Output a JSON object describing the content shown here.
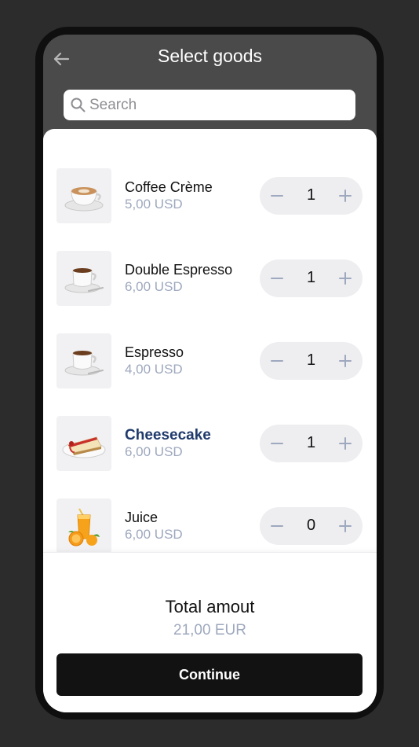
{
  "header": {
    "title": "Select goods",
    "back_icon": "arrow-left-icon"
  },
  "search": {
    "placeholder": "Search",
    "value": "",
    "icon": "search-icon"
  },
  "products": [
    {
      "name": "Coffee Crème",
      "price": "5,00 USD",
      "quantity": "1",
      "image": "cappuccino-cup"
    },
    {
      "name": "Double Espresso",
      "price": "6,00 USD",
      "quantity": "1",
      "image": "espresso-cup"
    },
    {
      "name": "Espresso",
      "price": "4,00 USD",
      "quantity": "1",
      "image": "espresso-cup"
    },
    {
      "name": "Cheesecake",
      "price": "6,00 USD",
      "quantity": "1",
      "image": "cheesecake-slice",
      "highlighted": true
    },
    {
      "name": "Juice",
      "price": "6,00 USD",
      "quantity": "0",
      "image": "orange-juice"
    }
  ],
  "stepper_icons": {
    "minus": "minus-icon",
    "plus": "plus-icon"
  },
  "footer": {
    "total_label": "Total amout",
    "total_value": "21,00 EUR",
    "continue_label": "Continue"
  },
  "colors": {
    "background": "#2c2c2c",
    "header_bg": "#4a4a4a",
    "price_text": "#9ea8be",
    "highlight_text": "#1f3a6b",
    "stepper_bg": "#eeeef1",
    "button_bg": "#121212"
  }
}
